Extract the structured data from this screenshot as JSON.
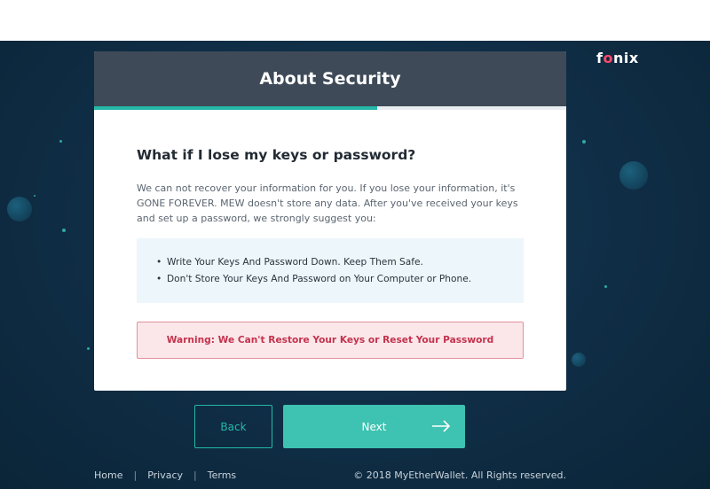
{
  "brand": {
    "logo_text_start": "f",
    "logo_mark": "o",
    "logo_text_end": "nix"
  },
  "card": {
    "title": "About Security",
    "progress": 0.6,
    "question": "What if I lose my keys or password?",
    "paragraph": "We can not recover your information for you. If you lose your information, it's GONE FOREVER. MEW doesn't store any data. After you've received your keys and set up a password, we strongly suggest you:",
    "tips": [
      "Write Your Keys And Password Down. Keep Them Safe.",
      "Don't Store Your Keys And Password on Your Computer or Phone."
    ],
    "warning": "Warning: We Can't Restore Your Keys or Reset Your Password"
  },
  "buttons": {
    "back": "Back",
    "next": "Next",
    "next_icon": "arrow-right-icon"
  },
  "footer": {
    "links": [
      "Home",
      "Privacy",
      "Terms"
    ],
    "copyright": "© 2018 MyEtherWallet. All Rights reserved."
  },
  "colors": {
    "accent": "#25b8a8",
    "header_bg": "#3e4a58",
    "page_bg": "#0e2c44",
    "warning_text": "#c4324c",
    "warning_bg": "#fbe7ea",
    "tips_bg": "#ecf6fb"
  }
}
